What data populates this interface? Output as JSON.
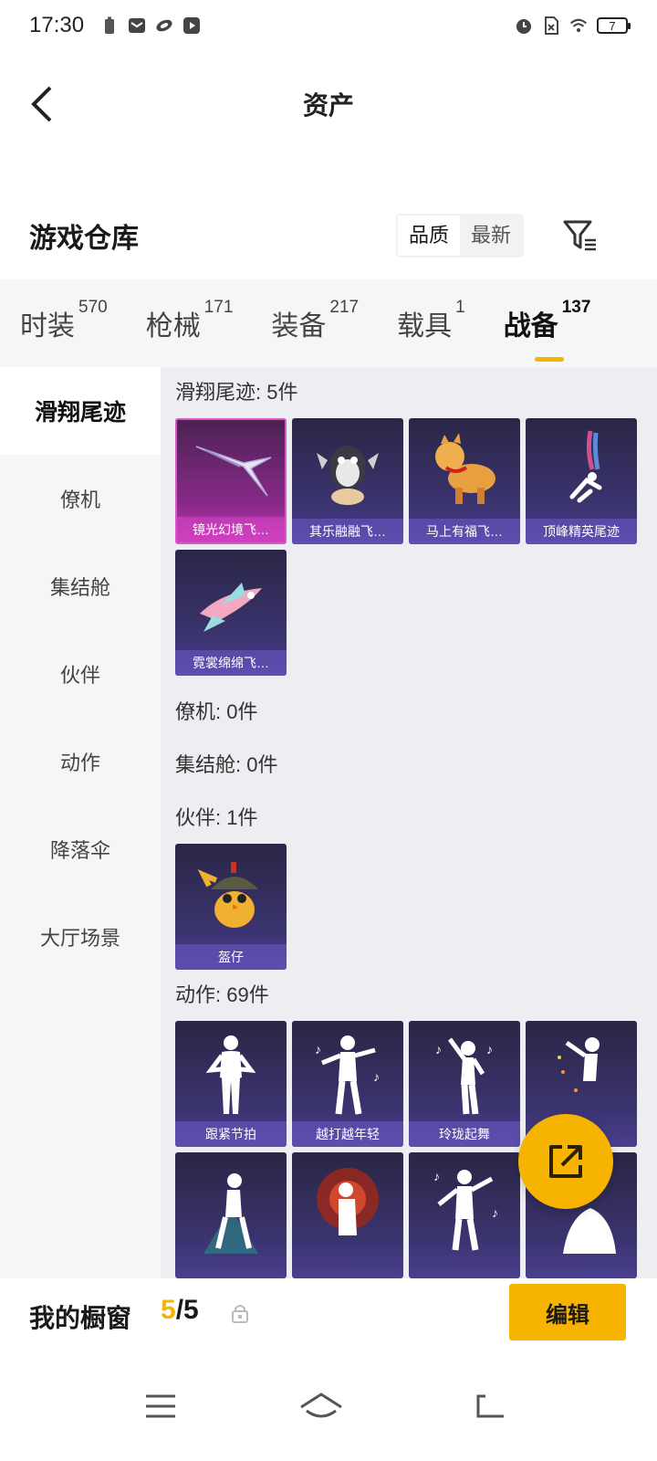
{
  "status_bar": {
    "time": "17:30",
    "battery_level": "7",
    "left_icons": [
      "battery-saver-icon",
      "mail-icon",
      "app-icon",
      "play-icon"
    ],
    "right_icons": [
      "alarm-icon",
      "no-sim-icon",
      "wifi-icon",
      "battery-icon"
    ]
  },
  "header": {
    "title": "资产",
    "back_icon": "back-arrow-icon"
  },
  "warehouse": {
    "title": "游戏仓库",
    "sort_options": [
      "品质",
      "最新"
    ],
    "active_sort": "品质",
    "filter_icon": "filter-icon"
  },
  "category_tabs": [
    {
      "label": "时装",
      "count": "570",
      "active": false
    },
    {
      "label": "枪械",
      "count": "171",
      "active": false
    },
    {
      "label": "装备",
      "count": "217",
      "active": false
    },
    {
      "label": "载具",
      "count": "1",
      "active": false
    },
    {
      "label": "战备",
      "count": "137",
      "active": true
    }
  ],
  "sidebar": {
    "items": [
      "滑翔尾迹",
      "僚机",
      "集结舱",
      "伙伴",
      "动作",
      "降落伞",
      "大厅场景"
    ],
    "active": "滑翔尾迹"
  },
  "sections": [
    {
      "title": "滑翔尾迹: 5件",
      "items": [
        "镜光幻境飞…",
        "其乐融融飞…",
        "马上有福飞…",
        "顶峰精英尾迹",
        "霓裳绵绵飞…"
      ]
    },
    {
      "title": "僚机: 0件",
      "items": []
    },
    {
      "title": "集结舱: 0件",
      "items": []
    },
    {
      "title": "伙伴: 1件",
      "items": [
        "盔仔"
      ]
    },
    {
      "title": "动作: 69件",
      "items": [
        "跟紧节拍",
        "越打越年轻",
        "玲珑起舞",
        "",
        "",
        "",
        "",
        ""
      ]
    }
  ],
  "showcase": {
    "title": "我的橱窗",
    "current": "5",
    "separator": "/",
    "total": "5",
    "edit_label": "编辑"
  },
  "colors": {
    "accent": "#f6b300",
    "card_bg": "#3b3470",
    "card_pink": "#c23ab8"
  }
}
